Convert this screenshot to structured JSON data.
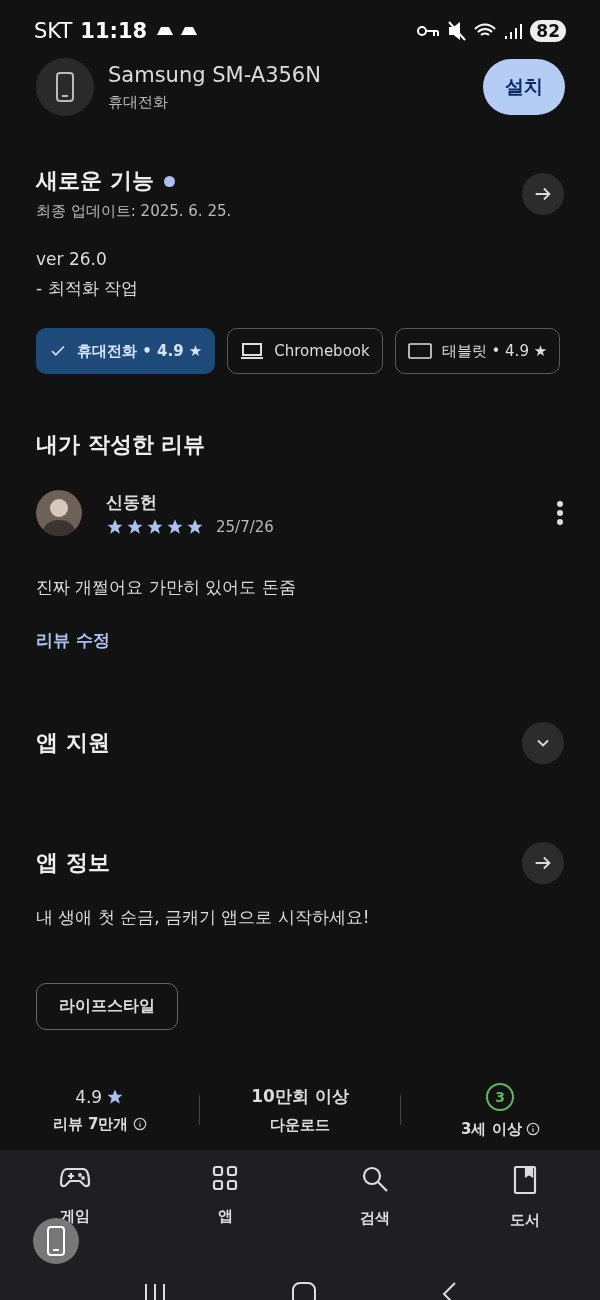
{
  "status_bar": {
    "carrier": "SKT",
    "time": "11:18",
    "battery": "82"
  },
  "device": {
    "name": "Samsung SM-A356N",
    "type": "휴대전화",
    "install_button": "설치"
  },
  "whats_new": {
    "title": "새로운 기능",
    "unread": true,
    "updated": "최종 업데이트: 2025. 6. 25.",
    "version": "ver 26.0",
    "notes": "- 최적화 작업"
  },
  "device_chips": [
    {
      "kind": "phone",
      "label": "휴대전화 • 4.9 ★",
      "selected": true
    },
    {
      "kind": "laptop",
      "label": "Chromebook",
      "selected": false
    },
    {
      "kind": "tablet",
      "label": "태블릿 • 4.9 ★",
      "selected": false
    }
  ],
  "my_review": {
    "title": "내가 작성한 리뷰",
    "author": "신동헌",
    "stars": 5,
    "date": "25/7/26",
    "text": "진짜 개쩔어요 가만히 있어도 돈줌",
    "edit_link": "리뷰 수정"
  },
  "sections": [
    {
      "kind": "expand",
      "title": "앱 지원"
    },
    {
      "kind": "arrow",
      "title": "앱 정보"
    }
  ],
  "description": "내 생애 첫 순금, 금캐기 앱으로 시작하세요!",
  "category": "라이프스타일",
  "stats": [
    {
      "kind": "rating",
      "value": "4.9",
      "label": "리뷰 7만개",
      "info": true
    },
    {
      "kind": "plain",
      "value": "10만회 이상",
      "label": "다운로드"
    },
    {
      "kind": "age",
      "value": "3",
      "label": "3세 이상",
      "info": true
    }
  ],
  "bottom_nav": [
    {
      "kind": "games",
      "label": "게임",
      "selected": false
    },
    {
      "kind": "apps",
      "label": "앱",
      "selected": false
    },
    {
      "kind": "search",
      "label": "검색",
      "selected": false
    },
    {
      "kind": "books",
      "label": "도서",
      "selected": false
    }
  ]
}
